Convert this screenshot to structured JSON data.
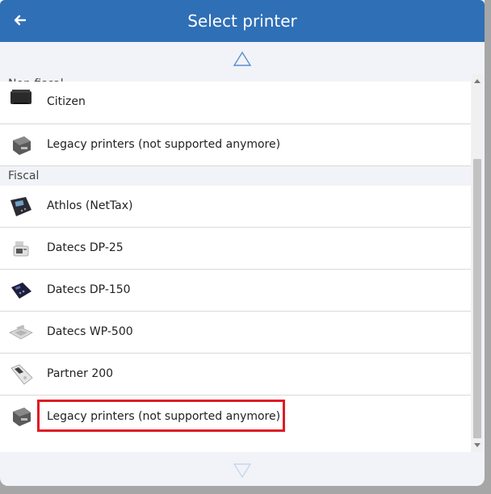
{
  "header": {
    "title": "Select printer",
    "back_icon": "arrow-left-icon",
    "background_color": "#2f6fb6"
  },
  "nav": {
    "scroll_up_icon": "triangle-up-icon",
    "scroll_down_icon": "triangle-down-icon"
  },
  "sections": [
    {
      "title": "Non fiscal",
      "items": [
        {
          "label": "Citizen",
          "icon": "printer-black-icon"
        },
        {
          "label": "Legacy printers (not supported anymore)",
          "icon": "printer-gray-icon"
        }
      ]
    },
    {
      "title": "Fiscal",
      "items": [
        {
          "label": "Athlos (NetTax)",
          "icon": "fiscal-device-dark-icon"
        },
        {
          "label": "Datecs DP-25",
          "icon": "cash-register-icon"
        },
        {
          "label": "Datecs DP-150",
          "icon": "fiscal-device-navy-icon"
        },
        {
          "label": "Datecs WP-500",
          "icon": "keyboard-register-icon"
        },
        {
          "label": "Partner 200",
          "icon": "handheld-device-icon"
        },
        {
          "label": "Legacy printers (not supported anymore)",
          "icon": "printer-gray-icon"
        }
      ]
    }
  ],
  "highlight_color": "#e01b24"
}
